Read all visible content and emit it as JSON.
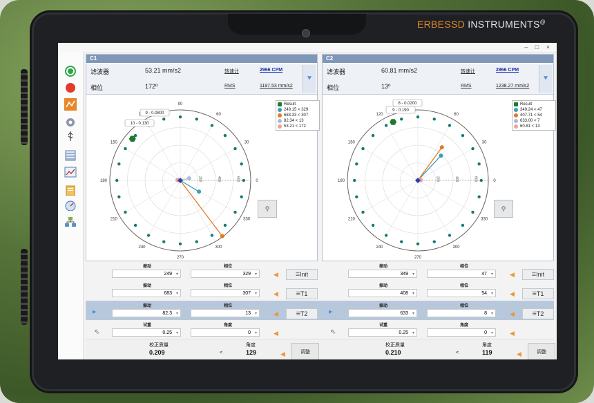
{
  "brand": {
    "name_part1": "ERBESSD",
    "name_part2": " INSTRUMENTS",
    "mark": "@"
  },
  "window": {
    "controls": "– □ ×"
  },
  "sidebar": {
    "items": [
      "run-icon",
      "stop-icon",
      "chart-tool-icon",
      "gear-icon",
      "usb-icon",
      "table-icon",
      "trend-icon",
      "clipboard-icon",
      "gauge-icon",
      "network-icon"
    ]
  },
  "panels": [
    {
      "title": "C1",
      "filter_label": "滤波器",
      "filter_value": "53.21 mm/s2",
      "rpm_label": "转速计",
      "rpm_value": "2966 CPM",
      "phase_label": "相位",
      "phase_value": "172º",
      "rms_label": "RMS",
      "rms_value": "1197.53 mm/s2",
      "callouts": [
        "9 - 0.0800",
        "10 - 0.130"
      ],
      "legend": [
        {
          "label": "Result",
          "color": "#1f7a2e",
          "shape": "hex"
        },
        {
          "label": "249.15 < 329",
          "color": "#3a9fb5"
        },
        {
          "label": "683.33 < 307",
          "color": "#e07b28"
        },
        {
          "label": "82.34 < 13",
          "color": "#a9bcd6"
        },
        {
          "label": "53.21 < 172",
          "color": "#e8a3a0"
        }
      ]
    },
    {
      "title": "C2",
      "filter_label": "滤波器",
      "filter_value": "60.81 mm/s2",
      "rpm_label": "转速计",
      "rpm_value": "2966 CPM",
      "phase_label": "相位",
      "phase_value": "13º",
      "rms_label": "RMS",
      "rms_value": "1238.27 mm/s2",
      "callouts": [
        "8 - 0.0200",
        "9 - 0.190"
      ],
      "legend": [
        {
          "label": "Result",
          "color": "#1f7a2e",
          "shape": "hex"
        },
        {
          "label": "349.24 < 47",
          "color": "#3a9fb5"
        },
        {
          "label": "407.71 < 54",
          "color": "#e07b28"
        },
        {
          "label": "633.00 < 7",
          "color": "#a9bcd6"
        },
        {
          "label": "60.81 < 13",
          "color": "#e8a3a0"
        }
      ]
    }
  ],
  "polar": {
    "angle_labels": [
      "90",
      "60",
      "30",
      "0",
      "330",
      "300",
      "270",
      "240",
      "210",
      "180",
      "150",
      "120"
    ],
    "radius_labels": [
      "200",
      "400",
      "600"
    ]
  },
  "controls": {
    "vib_label": "振动",
    "phase_label": "相位",
    "weight_label": "试重",
    "angle_label": "角度",
    "result_mass_label": "校正质量",
    "result_angle_label": "角度",
    "lt": "<",
    "adjust_label": "调整",
    "left": {
      "rows": [
        {
          "vib": "249",
          "phase": "329",
          "tag": "Init"
        },
        {
          "vib": "683",
          "phase": "307",
          "tag": "T1"
        },
        {
          "vib": "82.3",
          "phase": "13",
          "tag": "T2"
        }
      ],
      "weight": "0.25",
      "angle": "0",
      "result_mass": "0.209",
      "result_angle": "129"
    },
    "right": {
      "rows": [
        {
          "vib": "349",
          "phase": "47",
          "tag": "Init"
        },
        {
          "vib": "408",
          "phase": "54",
          "tag": "T1"
        },
        {
          "vib": "633",
          "phase": "8",
          "tag": "T2"
        }
      ],
      "weight": "0.25",
      "angle": "0",
      "result_mass": "0.210",
      "result_angle": "119"
    }
  }
}
